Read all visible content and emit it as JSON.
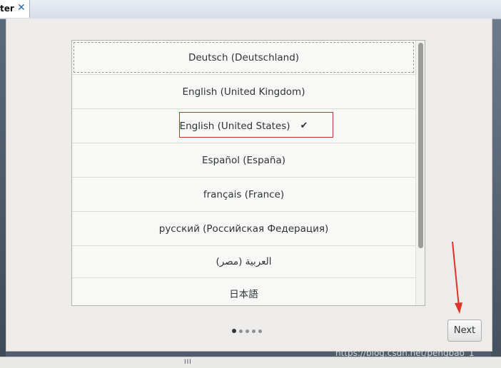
{
  "tab": {
    "title": "ter",
    "close_glyph": "✕"
  },
  "languages": [
    {
      "label": "Deutsch (Deutschland)",
      "selected": false
    },
    {
      "label": "English (United Kingdom)",
      "selected": false
    },
    {
      "label": "English (United States)",
      "selected": true
    },
    {
      "label": "Español (España)",
      "selected": false
    },
    {
      "label": "français (France)",
      "selected": false
    },
    {
      "label": "русский (Российская Федерация)",
      "selected": false
    },
    {
      "label": "العربية (مصر)",
      "selected": false
    },
    {
      "label": "日本語",
      "selected": false
    }
  ],
  "check_glyph": "✔",
  "pager": {
    "total": 5,
    "current": 1
  },
  "next_button_label": "Next",
  "bottom_grip": "III",
  "watermark": "https://blog.csdn.net/pengbao_1",
  "colors": {
    "highlight_border": "#c8312a",
    "annotation_arrow": "#e0322a"
  },
  "icons": {
    "check": "check-icon",
    "close": "close-icon",
    "arrow": "arrow-down-icon"
  }
}
